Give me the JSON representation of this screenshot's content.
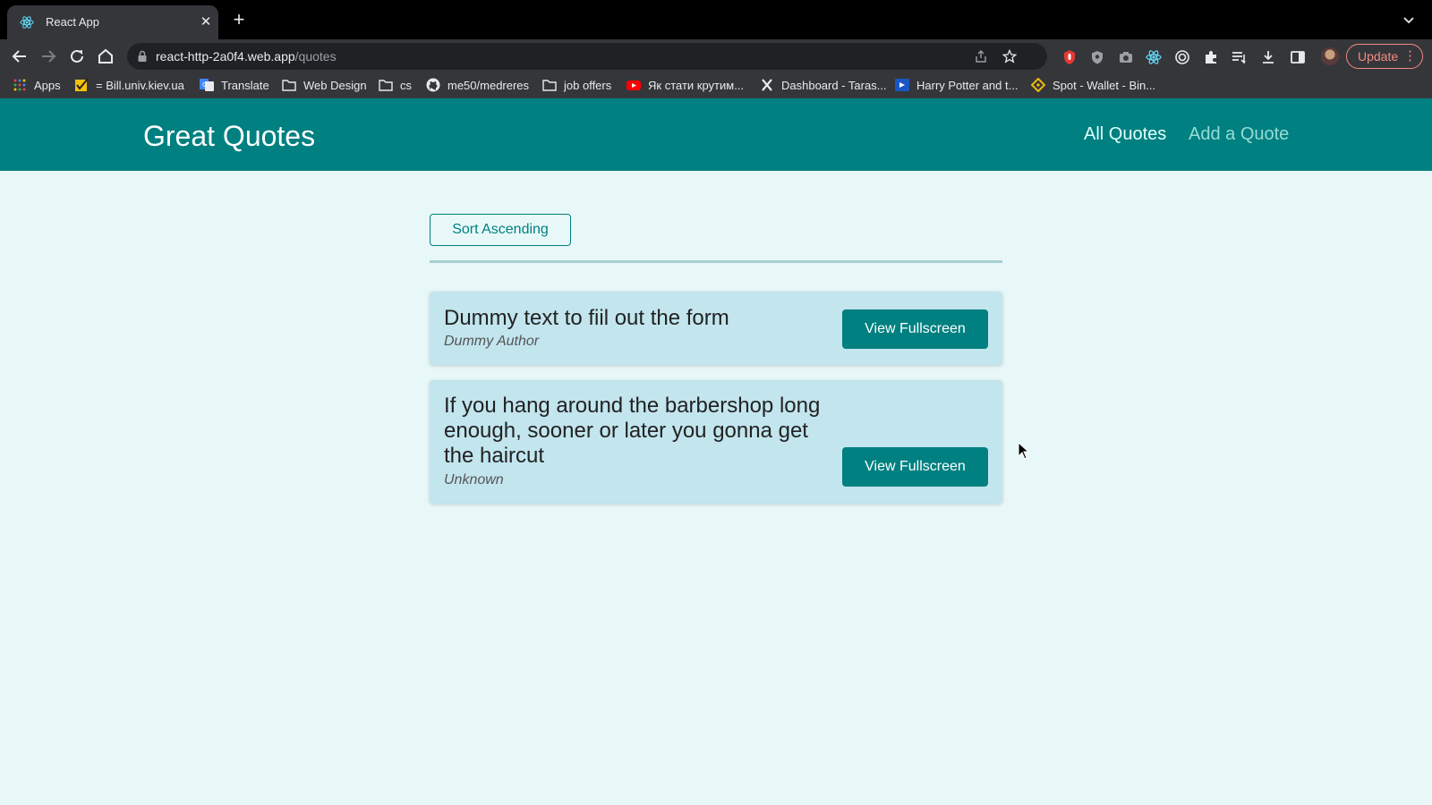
{
  "browser": {
    "tab_title": "React App",
    "tab_close": "✕",
    "new_tab": "+",
    "url_host": "react-http-2a0f4.web.app",
    "url_path": "/quotes",
    "update_label": "Update",
    "update_menu": "⋮",
    "bookmarks": [
      {
        "label": "Apps",
        "icon": "apps-grid-icon"
      },
      {
        "label": "= Bill.univ.kiev.ua",
        "icon": "checkbox-icon"
      },
      {
        "label": "Translate",
        "icon": "google-translate-icon"
      },
      {
        "label": "Web Design",
        "icon": "folder-icon"
      },
      {
        "label": "cs",
        "icon": "folder-icon"
      },
      {
        "label": "me50/medreres",
        "icon": "github-icon"
      },
      {
        "label": "job offers",
        "icon": "folder-icon"
      },
      {
        "label": "Як стати крутим...",
        "icon": "youtube-icon"
      },
      {
        "label": "Dashboard - Taras...",
        "icon": "x-icon"
      },
      {
        "label": "Harry Potter and t...",
        "icon": "video-icon"
      },
      {
        "label": "Spot - Wallet - Bin...",
        "icon": "binance-icon"
      }
    ]
  },
  "app": {
    "title": "Great Quotes",
    "nav": {
      "all_quotes": "All Quotes",
      "add_quote": "Add a Quote"
    },
    "sort_label": "Sort Ascending",
    "quotes": [
      {
        "text": "Dummy text to fiil out the form",
        "author": "Dummy Author",
        "button": "View Fullscreen"
      },
      {
        "text": "If you hang around the barbershop long enough, sooner or later you gonna get the haircut",
        "author": "Unknown",
        "button": "View Fullscreen"
      }
    ],
    "colors": {
      "brand": "#008080",
      "background": "#e8f8f8",
      "card": "#c2e5ee"
    }
  }
}
